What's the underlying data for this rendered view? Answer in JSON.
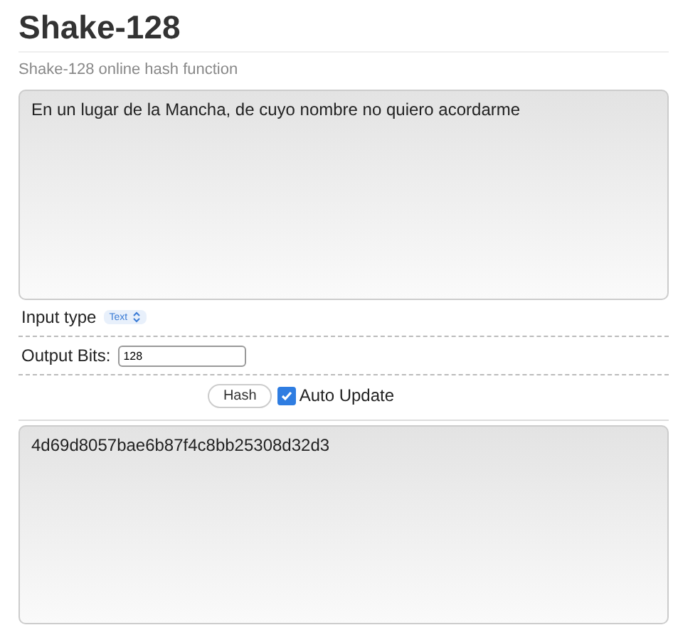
{
  "title": "Shake-128",
  "subtitle": "Shake-128 online hash function",
  "input": {
    "value": "En un lugar de la Mancha, de cuyo nombre no quiero acordarme"
  },
  "input_type": {
    "label": "Input type",
    "value": "Text"
  },
  "output_bits": {
    "label": "Output Bits:",
    "value": "128"
  },
  "hash_button": "Hash",
  "auto_update": {
    "label": "Auto Update",
    "checked": true
  },
  "output": {
    "value": "4d69d8057bae6b87f4c8bb25308d32d3"
  }
}
